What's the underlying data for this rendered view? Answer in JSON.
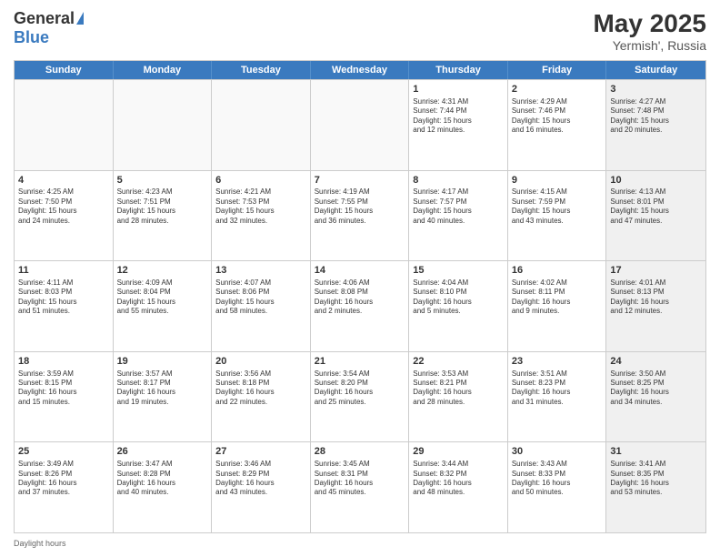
{
  "header": {
    "logo_general": "General",
    "logo_blue": "Blue",
    "month": "May 2025",
    "location": "Yermish', Russia"
  },
  "weekdays": [
    "Sunday",
    "Monday",
    "Tuesday",
    "Wednesday",
    "Thursday",
    "Friday",
    "Saturday"
  ],
  "rows": [
    [
      {
        "day": "",
        "text": "",
        "empty": true
      },
      {
        "day": "",
        "text": "",
        "empty": true
      },
      {
        "day": "",
        "text": "",
        "empty": true
      },
      {
        "day": "",
        "text": "",
        "empty": true
      },
      {
        "day": "1",
        "text": "Sunrise: 4:31 AM\nSunset: 7:44 PM\nDaylight: 15 hours\nand 12 minutes.",
        "empty": false
      },
      {
        "day": "2",
        "text": "Sunrise: 4:29 AM\nSunset: 7:46 PM\nDaylight: 15 hours\nand 16 minutes.",
        "empty": false
      },
      {
        "day": "3",
        "text": "Sunrise: 4:27 AM\nSunset: 7:48 PM\nDaylight: 15 hours\nand 20 minutes.",
        "empty": false,
        "shaded": true
      }
    ],
    [
      {
        "day": "4",
        "text": "Sunrise: 4:25 AM\nSunset: 7:50 PM\nDaylight: 15 hours\nand 24 minutes.",
        "empty": false
      },
      {
        "day": "5",
        "text": "Sunrise: 4:23 AM\nSunset: 7:51 PM\nDaylight: 15 hours\nand 28 minutes.",
        "empty": false
      },
      {
        "day": "6",
        "text": "Sunrise: 4:21 AM\nSunset: 7:53 PM\nDaylight: 15 hours\nand 32 minutes.",
        "empty": false
      },
      {
        "day": "7",
        "text": "Sunrise: 4:19 AM\nSunset: 7:55 PM\nDaylight: 15 hours\nand 36 minutes.",
        "empty": false
      },
      {
        "day": "8",
        "text": "Sunrise: 4:17 AM\nSunset: 7:57 PM\nDaylight: 15 hours\nand 40 minutes.",
        "empty": false
      },
      {
        "day": "9",
        "text": "Sunrise: 4:15 AM\nSunset: 7:59 PM\nDaylight: 15 hours\nand 43 minutes.",
        "empty": false
      },
      {
        "day": "10",
        "text": "Sunrise: 4:13 AM\nSunset: 8:01 PM\nDaylight: 15 hours\nand 47 minutes.",
        "empty": false,
        "shaded": true
      }
    ],
    [
      {
        "day": "11",
        "text": "Sunrise: 4:11 AM\nSunset: 8:03 PM\nDaylight: 15 hours\nand 51 minutes.",
        "empty": false
      },
      {
        "day": "12",
        "text": "Sunrise: 4:09 AM\nSunset: 8:04 PM\nDaylight: 15 hours\nand 55 minutes.",
        "empty": false
      },
      {
        "day": "13",
        "text": "Sunrise: 4:07 AM\nSunset: 8:06 PM\nDaylight: 15 hours\nand 58 minutes.",
        "empty": false
      },
      {
        "day": "14",
        "text": "Sunrise: 4:06 AM\nSunset: 8:08 PM\nDaylight: 16 hours\nand 2 minutes.",
        "empty": false
      },
      {
        "day": "15",
        "text": "Sunrise: 4:04 AM\nSunset: 8:10 PM\nDaylight: 16 hours\nand 5 minutes.",
        "empty": false
      },
      {
        "day": "16",
        "text": "Sunrise: 4:02 AM\nSunset: 8:11 PM\nDaylight: 16 hours\nand 9 minutes.",
        "empty": false
      },
      {
        "day": "17",
        "text": "Sunrise: 4:01 AM\nSunset: 8:13 PM\nDaylight: 16 hours\nand 12 minutes.",
        "empty": false,
        "shaded": true
      }
    ],
    [
      {
        "day": "18",
        "text": "Sunrise: 3:59 AM\nSunset: 8:15 PM\nDaylight: 16 hours\nand 15 minutes.",
        "empty": false
      },
      {
        "day": "19",
        "text": "Sunrise: 3:57 AM\nSunset: 8:17 PM\nDaylight: 16 hours\nand 19 minutes.",
        "empty": false
      },
      {
        "day": "20",
        "text": "Sunrise: 3:56 AM\nSunset: 8:18 PM\nDaylight: 16 hours\nand 22 minutes.",
        "empty": false
      },
      {
        "day": "21",
        "text": "Sunrise: 3:54 AM\nSunset: 8:20 PM\nDaylight: 16 hours\nand 25 minutes.",
        "empty": false
      },
      {
        "day": "22",
        "text": "Sunrise: 3:53 AM\nSunset: 8:21 PM\nDaylight: 16 hours\nand 28 minutes.",
        "empty": false
      },
      {
        "day": "23",
        "text": "Sunrise: 3:51 AM\nSunset: 8:23 PM\nDaylight: 16 hours\nand 31 minutes.",
        "empty": false
      },
      {
        "day": "24",
        "text": "Sunrise: 3:50 AM\nSunset: 8:25 PM\nDaylight: 16 hours\nand 34 minutes.",
        "empty": false,
        "shaded": true
      }
    ],
    [
      {
        "day": "25",
        "text": "Sunrise: 3:49 AM\nSunset: 8:26 PM\nDaylight: 16 hours\nand 37 minutes.",
        "empty": false
      },
      {
        "day": "26",
        "text": "Sunrise: 3:47 AM\nSunset: 8:28 PM\nDaylight: 16 hours\nand 40 minutes.",
        "empty": false
      },
      {
        "day": "27",
        "text": "Sunrise: 3:46 AM\nSunset: 8:29 PM\nDaylight: 16 hours\nand 43 minutes.",
        "empty": false
      },
      {
        "day": "28",
        "text": "Sunrise: 3:45 AM\nSunset: 8:31 PM\nDaylight: 16 hours\nand 45 minutes.",
        "empty": false
      },
      {
        "day": "29",
        "text": "Sunrise: 3:44 AM\nSunset: 8:32 PM\nDaylight: 16 hours\nand 48 minutes.",
        "empty": false
      },
      {
        "day": "30",
        "text": "Sunrise: 3:43 AM\nSunset: 8:33 PM\nDaylight: 16 hours\nand 50 minutes.",
        "empty": false
      },
      {
        "day": "31",
        "text": "Sunrise: 3:41 AM\nSunset: 8:35 PM\nDaylight: 16 hours\nand 53 minutes.",
        "empty": false,
        "shaded": true
      }
    ]
  ],
  "footer": {
    "daylight_label": "Daylight hours"
  }
}
